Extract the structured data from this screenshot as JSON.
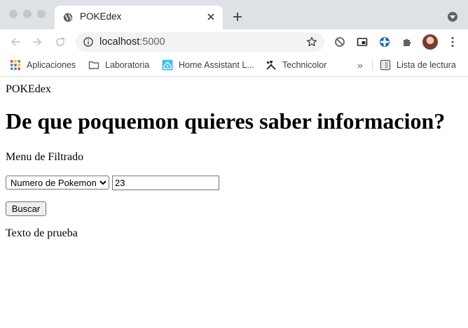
{
  "browser": {
    "tab": {
      "title": "POKEdex",
      "favicon": "globe-icon"
    },
    "address": {
      "host": "localhost",
      "port": ":5000"
    },
    "bookmarks": [
      {
        "label": "Aplicaciones",
        "icon": "apps-grid-icon"
      },
      {
        "label": "Laboratoria",
        "icon": "folder-icon"
      },
      {
        "label": "Home Assistant L...",
        "icon": "home-assistant-icon"
      },
      {
        "label": "Technicolor",
        "icon": "tools-icon"
      }
    ],
    "reading_list": {
      "label": "Lista de lectura",
      "icon": "reading-list-icon"
    },
    "more": "»"
  },
  "page": {
    "site_name": "POKEdex",
    "heading": "De que poquemon quieres saber informacion?",
    "menu_label": "Menu de Filtrado",
    "filter": {
      "selected": "Numero de Pokemon",
      "value": "23"
    },
    "search_button": "Buscar",
    "sample_text": "Texto de prueba"
  },
  "colors": {
    "tabstrip": "#dee1e6",
    "omnibox": "#f1f3f4",
    "icon": "#5f6368"
  }
}
